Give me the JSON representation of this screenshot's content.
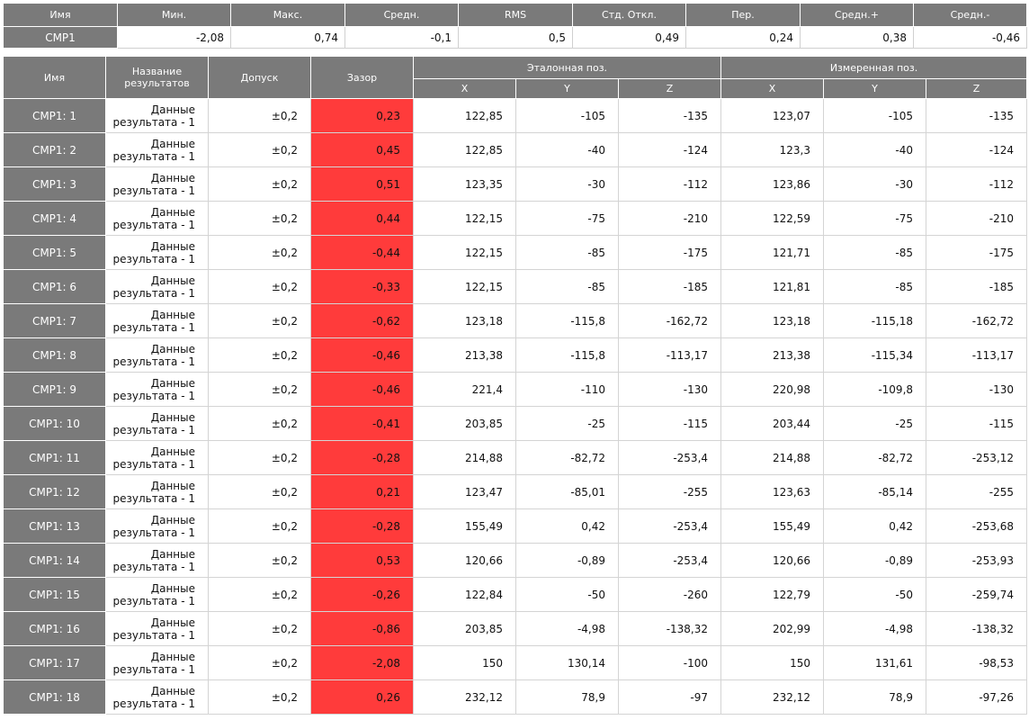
{
  "summary": {
    "headers": [
      "Имя",
      "Мин.",
      "Макс.",
      "Средн.",
      "RMS",
      "Стд. Откл.",
      "Пер.",
      "Средн.+",
      "Средн.-"
    ],
    "row": [
      "CMP1",
      "-2,08",
      "0,74",
      "-0,1",
      "0,5",
      "0,49",
      "0,24",
      "0,38",
      "-0,46"
    ]
  },
  "table": {
    "headers": {
      "name": "Имя",
      "result_title": "Название результатов",
      "tolerance": "Допуск",
      "gap": "Зазор",
      "ref_group": "Эталонная поз.",
      "meas_group": "Измеренная поз.",
      "x": "X",
      "y": "Y",
      "z": "Z"
    },
    "gap_color": "#ff3b3b",
    "rows": [
      {
        "name": "CMP1: 1",
        "title": "Данные результата - 1",
        "tol": "±0,2",
        "gap": "0,23",
        "rx": "122,85",
        "ry": "-105",
        "rz": "-135",
        "mx": "123,07",
        "my": "-105",
        "mz": "-135"
      },
      {
        "name": "CMP1: 2",
        "title": "Данные результата - 1",
        "tol": "±0,2",
        "gap": "0,45",
        "rx": "122,85",
        "ry": "-40",
        "rz": "-124",
        "mx": "123,3",
        "my": "-40",
        "mz": "-124"
      },
      {
        "name": "CMP1: 3",
        "title": "Данные результата - 1",
        "tol": "±0,2",
        "gap": "0,51",
        "rx": "123,35",
        "ry": "-30",
        "rz": "-112",
        "mx": "123,86",
        "my": "-30",
        "mz": "-112"
      },
      {
        "name": "CMP1: 4",
        "title": "Данные результата - 1",
        "tol": "±0,2",
        "gap": "0,44",
        "rx": "122,15",
        "ry": "-75",
        "rz": "-210",
        "mx": "122,59",
        "my": "-75",
        "mz": "-210"
      },
      {
        "name": "CMP1: 5",
        "title": "Данные результата - 1",
        "tol": "±0,2",
        "gap": "-0,44",
        "rx": "122,15",
        "ry": "-85",
        "rz": "-175",
        "mx": "121,71",
        "my": "-85",
        "mz": "-175"
      },
      {
        "name": "CMP1: 6",
        "title": "Данные результата - 1",
        "tol": "±0,2",
        "gap": "-0,33",
        "rx": "122,15",
        "ry": "-85",
        "rz": "-185",
        "mx": "121,81",
        "my": "-85",
        "mz": "-185"
      },
      {
        "name": "CMP1: 7",
        "title": "Данные результата - 1",
        "tol": "±0,2",
        "gap": "-0,62",
        "rx": "123,18",
        "ry": "-115,8",
        "rz": "-162,72",
        "mx": "123,18",
        "my": "-115,18",
        "mz": "-162,72"
      },
      {
        "name": "CMP1: 8",
        "title": "Данные результата - 1",
        "tol": "±0,2",
        "gap": "-0,46",
        "rx": "213,38",
        "ry": "-115,8",
        "rz": "-113,17",
        "mx": "213,38",
        "my": "-115,34",
        "mz": "-113,17"
      },
      {
        "name": "CMP1: 9",
        "title": "Данные результата - 1",
        "tol": "±0,2",
        "gap": "-0,46",
        "rx": "221,4",
        "ry": "-110",
        "rz": "-130",
        "mx": "220,98",
        "my": "-109,8",
        "mz": "-130"
      },
      {
        "name": "CMP1: 10",
        "title": "Данные результата - 1",
        "tol": "±0,2",
        "gap": "-0,41",
        "rx": "203,85",
        "ry": "-25",
        "rz": "-115",
        "mx": "203,44",
        "my": "-25",
        "mz": "-115"
      },
      {
        "name": "CMP1: 11",
        "title": "Данные результата - 1",
        "tol": "±0,2",
        "gap": "-0,28",
        "rx": "214,88",
        "ry": "-82,72",
        "rz": "-253,4",
        "mx": "214,88",
        "my": "-82,72",
        "mz": "-253,12"
      },
      {
        "name": "CMP1: 12",
        "title": "Данные результата - 1",
        "tol": "±0,2",
        "gap": "0,21",
        "rx": "123,47",
        "ry": "-85,01",
        "rz": "-255",
        "mx": "123,63",
        "my": "-85,14",
        "mz": "-255"
      },
      {
        "name": "CMP1: 13",
        "title": "Данные результата - 1",
        "tol": "±0,2",
        "gap": "-0,28",
        "rx": "155,49",
        "ry": "0,42",
        "rz": "-253,4",
        "mx": "155,49",
        "my": "0,42",
        "mz": "-253,68"
      },
      {
        "name": "CMP1: 14",
        "title": "Данные результата - 1",
        "tol": "±0,2",
        "gap": "0,53",
        "rx": "120,66",
        "ry": "-0,89",
        "rz": "-253,4",
        "mx": "120,66",
        "my": "-0,89",
        "mz": "-253,93"
      },
      {
        "name": "CMP1: 15",
        "title": "Данные результата - 1",
        "tol": "±0,2",
        "gap": "-0,26",
        "rx": "122,84",
        "ry": "-50",
        "rz": "-260",
        "mx": "122,79",
        "my": "-50",
        "mz": "-259,74"
      },
      {
        "name": "CMP1: 16",
        "title": "Данные результата - 1",
        "tol": "±0,2",
        "gap": "-0,86",
        "rx": "203,85",
        "ry": "-4,98",
        "rz": "-138,32",
        "mx": "202,99",
        "my": "-4,98",
        "mz": "-138,32"
      },
      {
        "name": "CMP1: 17",
        "title": "Данные результата - 1",
        "tol": "±0,2",
        "gap": "-2,08",
        "rx": "150",
        "ry": "130,14",
        "rz": "-100",
        "mx": "150",
        "my": "131,61",
        "mz": "-98,53"
      },
      {
        "name": "CMP1: 18",
        "title": "Данные результата - 1",
        "tol": "±0,2",
        "gap": "0,26",
        "rx": "232,12",
        "ry": "78,9",
        "rz": "-97",
        "mx": "232,12",
        "my": "78,9",
        "mz": "-97,26"
      }
    ]
  }
}
